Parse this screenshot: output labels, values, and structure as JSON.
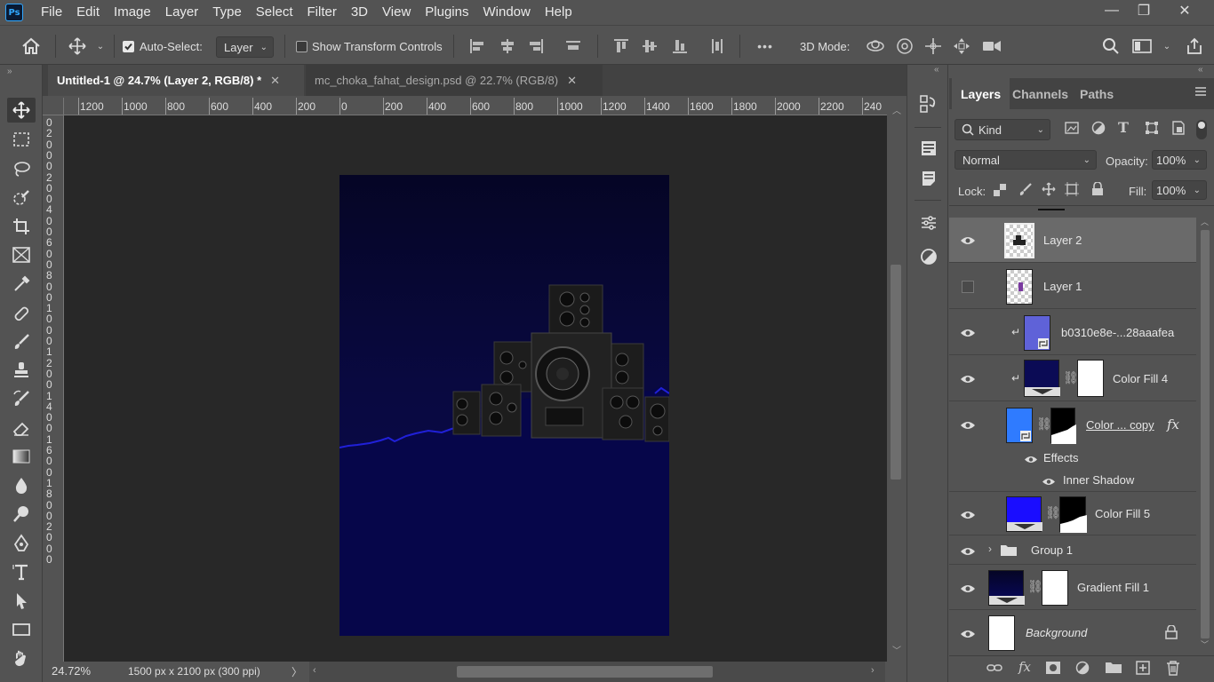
{
  "app": {
    "logo": "Ps"
  },
  "menu": [
    "File",
    "Edit",
    "Image",
    "Layer",
    "Type",
    "Select",
    "Filter",
    "3D",
    "View",
    "Plugins",
    "Window",
    "Help"
  ],
  "window_controls": {
    "minimize": "—",
    "restore": "❐",
    "close": "✕"
  },
  "options": {
    "auto_select_label": "Auto-Select:",
    "auto_select_checked": true,
    "auto_select_target": "Layer",
    "show_transform_label": "Show Transform Controls",
    "more": "•••",
    "mode_3d_label": "3D Mode:"
  },
  "tabs": [
    {
      "label": "Untitled-1 @ 24.7% (Layer 2, RGB/8) *",
      "close": "✕",
      "active": true
    },
    {
      "label": "mc_choka_fahat_design.psd @ 22.7% (RGB/8)",
      "close": "✕",
      "active": false
    }
  ],
  "ruler": {
    "top_ticks": [
      "1200",
      "1000",
      "800",
      "600",
      "400",
      "200",
      "0",
      "200",
      "400",
      "600",
      "800",
      "1000",
      "1200",
      "1400",
      "1600",
      "1800",
      "2000",
      "2200",
      "240"
    ],
    "left_ticks": [
      "0",
      "2",
      "0",
      "0",
      "0",
      "2",
      "0",
      "0",
      "4",
      "0",
      "0",
      "6",
      "0",
      "0",
      "8",
      "0",
      "0",
      "1",
      "0",
      "0",
      "0",
      "1",
      "2",
      "0",
      "0",
      "1",
      "4",
      "0",
      "0",
      "1",
      "6",
      "0",
      "0",
      "1",
      "8",
      "0",
      "0",
      "2",
      "0",
      "0",
      "0"
    ]
  },
  "status": {
    "zoom": "24.72%",
    "doc_info": "1500 px x 2100 px (300 ppi)",
    "arrow": "〉"
  },
  "panel": {
    "tabs": [
      "Layers",
      "Channels",
      "Paths"
    ],
    "filter_kind": "Kind",
    "blend_mode": "Normal",
    "opacity_label": "Opacity:",
    "opacity_value": "100%",
    "lock_label": "Lock:",
    "fill_label": "Fill:",
    "fill_value": "100%"
  },
  "layers": [
    {
      "name": "Layer 2",
      "visible": true,
      "selected": true
    },
    {
      "name": "Layer 1",
      "visible": false
    },
    {
      "name": "b0310e8e-...28aaafea",
      "visible": true,
      "clipped": true
    },
    {
      "name": "Color Fill 4",
      "visible": true,
      "clipped": true
    },
    {
      "name": "Color ... copy",
      "visible": true,
      "fx": "fx"
    },
    {
      "name": "Effects",
      "visible": true
    },
    {
      "name": "Inner Shadow",
      "visible": true
    },
    {
      "name": "Color Fill 5",
      "visible": true
    },
    {
      "name": "Group 1",
      "visible": true
    },
    {
      "name": "Gradient Fill 1",
      "visible": true
    },
    {
      "name": "Background",
      "visible": true,
      "locked": true
    }
  ],
  "colors": {
    "ui_bg": "#535353",
    "canvas_bg": "#282828",
    "doc_dark": "#050525",
    "doc_navy": "#08084f",
    "wave": "#1d1dd0",
    "color_fill_4": "#0b0b55",
    "color_copy": "#2f7bff",
    "color_fill_5": "#1a0dff"
  }
}
